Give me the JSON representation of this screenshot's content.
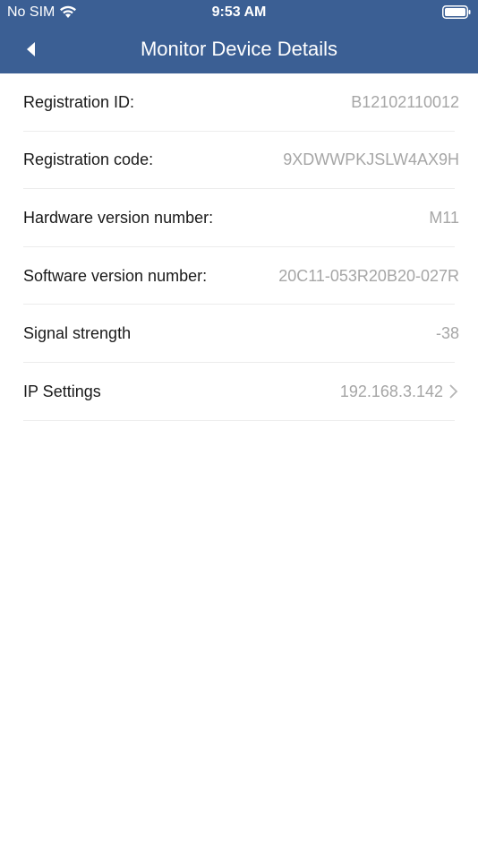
{
  "status_bar": {
    "carrier": "No SIM",
    "time": "9:53 AM"
  },
  "nav": {
    "title": "Monitor Device Details",
    "back_icon": "back-arrow-icon"
  },
  "details": [
    {
      "label": "Registration ID:",
      "value": "B12102110012"
    },
    {
      "label": "Registration code:",
      "value": "9XDWWPKJSLW4AX9H"
    },
    {
      "label": "Hardware version number:",
      "value": "M11"
    },
    {
      "label": "Software version number:",
      "value": "20C11-053R20B20-027R"
    },
    {
      "label": "Signal strength",
      "value": "-38"
    },
    {
      "label": "IP Settings",
      "value": "192.168.3.142",
      "icon": "chevron-right-icon"
    }
  ],
  "colors": {
    "header_bg": "#3b5f94",
    "label_text": "#1a1a1a",
    "value_text": "#a6a6a6",
    "divider": "#ececec"
  }
}
